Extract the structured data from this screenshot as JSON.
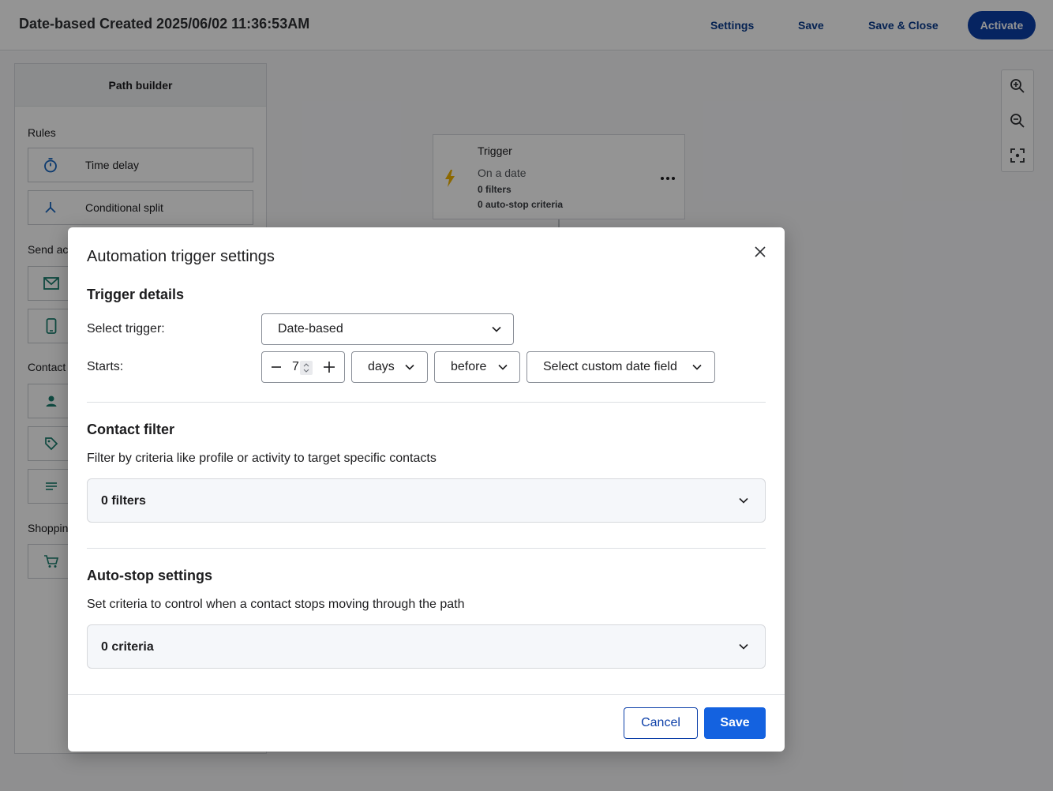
{
  "header": {
    "title": "Date-based Created 2025/06/02 11:36:53AM",
    "settings_label": "Settings",
    "save_label": "Save",
    "save_close_label": "Save & Close",
    "activate_label": "Activate"
  },
  "sidebar": {
    "title": "Path builder",
    "sections": {
      "rules": "Rules",
      "send": "Send ac",
      "contact": "Contact",
      "shopping": "Shoppin"
    },
    "rules_items": [
      {
        "label": "Time delay",
        "icon": "stopwatch-icon"
      },
      {
        "label": "Conditional split",
        "icon": "split-icon"
      }
    ]
  },
  "trigger_node": {
    "title": "Trigger",
    "subtitle": "On a date",
    "filters": "0 filters",
    "autostop": "0 auto-stop criteria"
  },
  "modal": {
    "title": "Automation trigger settings",
    "trigger_details": {
      "heading": "Trigger details",
      "select_trigger_label": "Select trigger:",
      "select_trigger_value": "Date-based",
      "starts_label": "Starts:",
      "starts_value": "7",
      "unit_value": "days",
      "direction_value": "before",
      "date_field_value": "Select custom date field"
    },
    "contact_filter": {
      "heading": "Contact filter",
      "description": "Filter by criteria like profile or activity to target specific contacts",
      "summary": "0 filters"
    },
    "auto_stop": {
      "heading": "Auto-stop settings",
      "description": "Set criteria to control when a contact stops moving through the path",
      "summary": "0 criteria"
    },
    "cancel_label": "Cancel",
    "save_label": "Save"
  },
  "colors": {
    "primary": "#1462e0",
    "header_button": "#0b3ea8",
    "trigger_icon": "#f2b400"
  }
}
